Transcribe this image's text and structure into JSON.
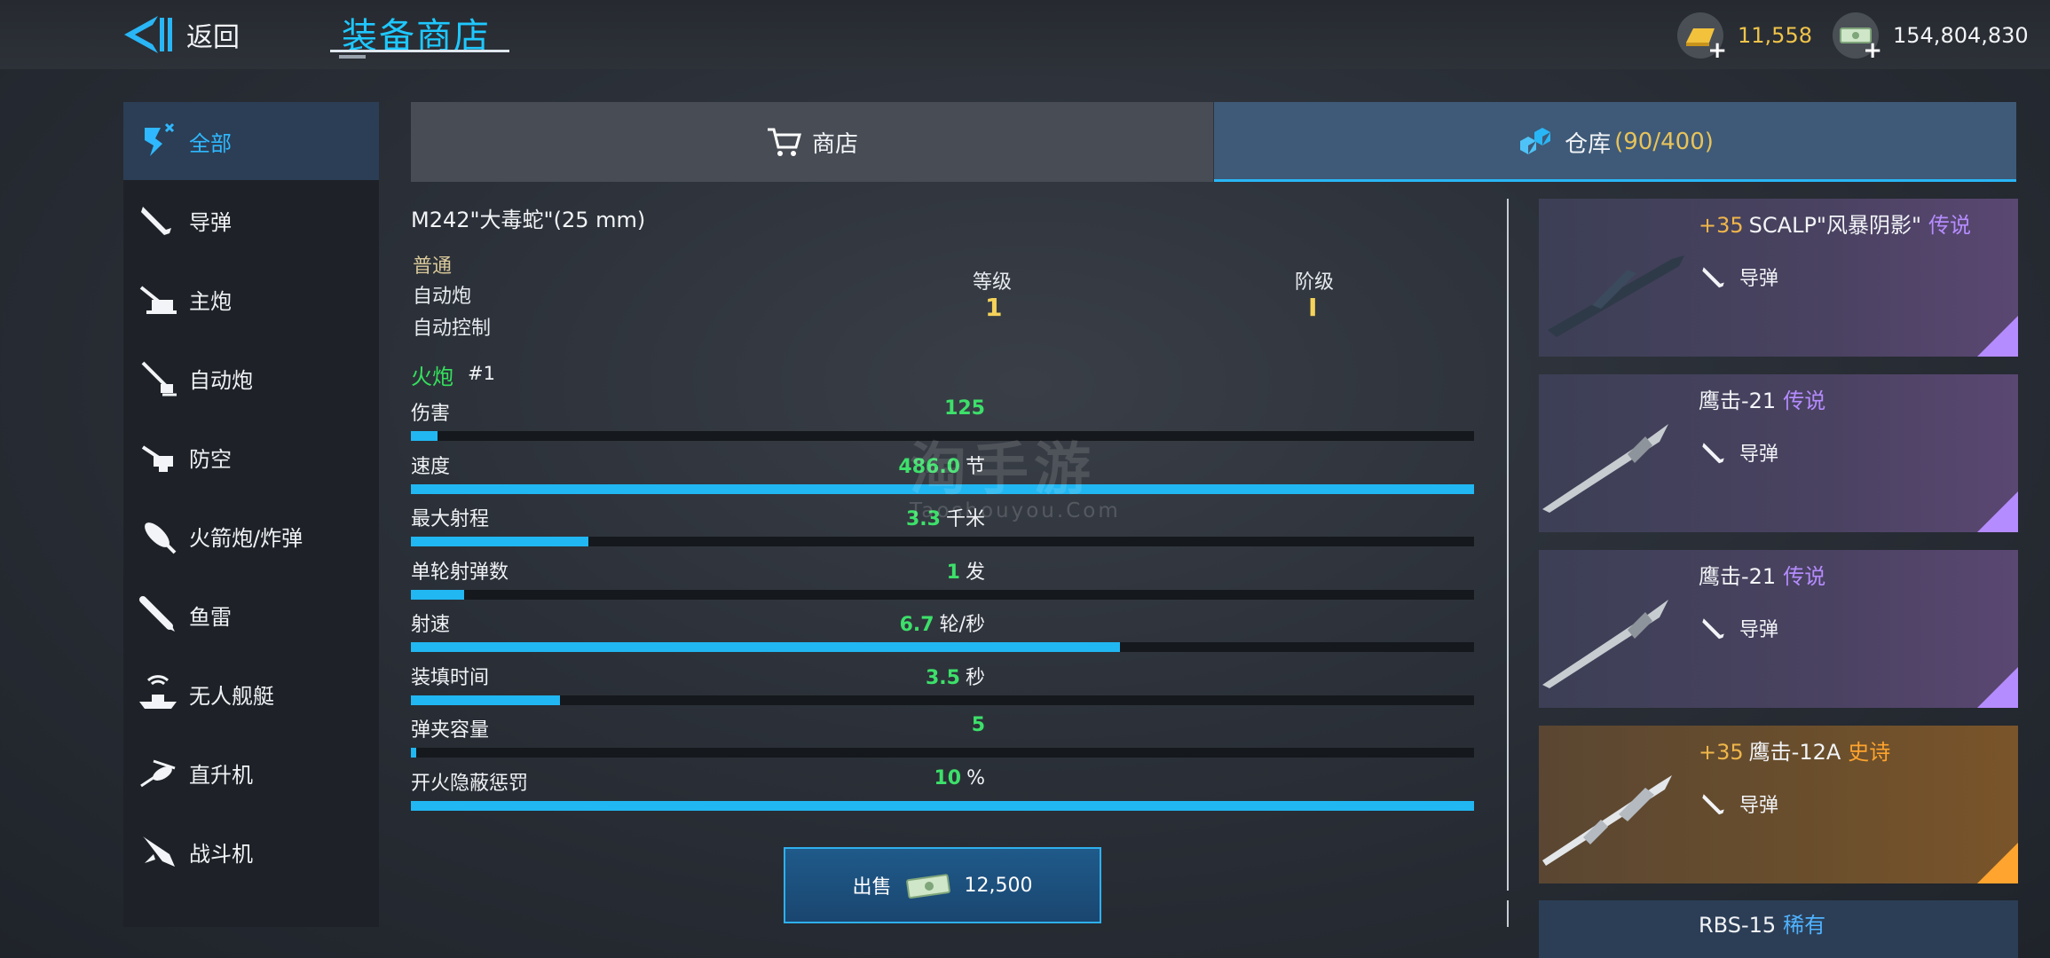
{
  "header": {
    "back_label": "返回",
    "title": "装备商店",
    "gold_value": "11,558",
    "cash_value": "154,804,830"
  },
  "sidebar": {
    "items": [
      {
        "label": "全部",
        "icon": "all-icon",
        "active": true
      },
      {
        "label": "导弹",
        "icon": "missile-icon"
      },
      {
        "label": "主炮",
        "icon": "main-gun-icon"
      },
      {
        "label": "自动炮",
        "icon": "autocannon-icon"
      },
      {
        "label": "防空",
        "icon": "anti-air-icon"
      },
      {
        "label": "火箭炮/炸弹",
        "icon": "rocket-bomb-icon"
      },
      {
        "label": "鱼雷",
        "icon": "torpedo-icon"
      },
      {
        "label": "无人舰艇",
        "icon": "drone-boat-icon"
      },
      {
        "label": "直升机",
        "icon": "helicopter-icon"
      },
      {
        "label": "战斗机",
        "icon": "fighter-jet-icon"
      }
    ]
  },
  "tabs": {
    "shop_label": "商店",
    "storage_label": "仓库",
    "storage_count": "(90/400)"
  },
  "detail": {
    "name": "M242\"大毒蛇\"(25 mm)",
    "rarity": "普通",
    "type1": "自动炮",
    "type2": "自动控制",
    "level_label": "等级",
    "level_value": "1",
    "tier_label": "阶级",
    "tier_value": "I",
    "weapon_label": "火炮",
    "weapon_num": "#1",
    "stats": [
      {
        "label": "伤害",
        "value": "125",
        "unit": "",
        "fill": 0.025
      },
      {
        "label": "速度",
        "value": "486.0",
        "unit": "节",
        "fill": 1.0
      },
      {
        "label": "最大射程",
        "value": "3.3",
        "unit": "千米",
        "fill": 0.167
      },
      {
        "label": "单轮射弹数",
        "value": "1",
        "unit": "发",
        "fill": 0.05
      },
      {
        "label": "射速",
        "value": "6.7",
        "unit": "轮/秒",
        "fill": 0.667
      },
      {
        "label": "装填时间",
        "value": "3.5",
        "unit": "秒",
        "fill": 0.14
      },
      {
        "label": "弹夹容量",
        "value": "5",
        "unit": "",
        "fill": 0.005
      },
      {
        "label": "开火隐蔽惩罚",
        "value": "10",
        "unit": "%",
        "fill": 1.0
      }
    ],
    "sell_label": "出售",
    "sell_price": "12,500"
  },
  "inventory": [
    {
      "plus": "+35",
      "name": "SCALP\"风暴阴影\"",
      "rarity": "传说",
      "type": "导弹",
      "grade": "legend"
    },
    {
      "plus": "",
      "name": "鹰击-21",
      "rarity": "传说",
      "type": "导弹",
      "grade": "legend"
    },
    {
      "plus": "",
      "name": "鹰击-21",
      "rarity": "传说",
      "type": "导弹",
      "grade": "legend"
    },
    {
      "plus": "+35",
      "name": "鹰击-12A",
      "rarity": "史诗",
      "type": "导弹",
      "grade": "epic"
    },
    {
      "plus": "",
      "name": "RBS-15",
      "rarity": "稀有",
      "type": "",
      "grade": "rare"
    }
  ],
  "watermark": {
    "main": "淘手游",
    "sub": "Taoshouyou.Com"
  },
  "colors": {
    "accent": "#21b7f2",
    "stat_value": "#3de06a",
    "legend": "#b58cff",
    "epic": "#ffa42e",
    "gold": "#f0c44a"
  }
}
